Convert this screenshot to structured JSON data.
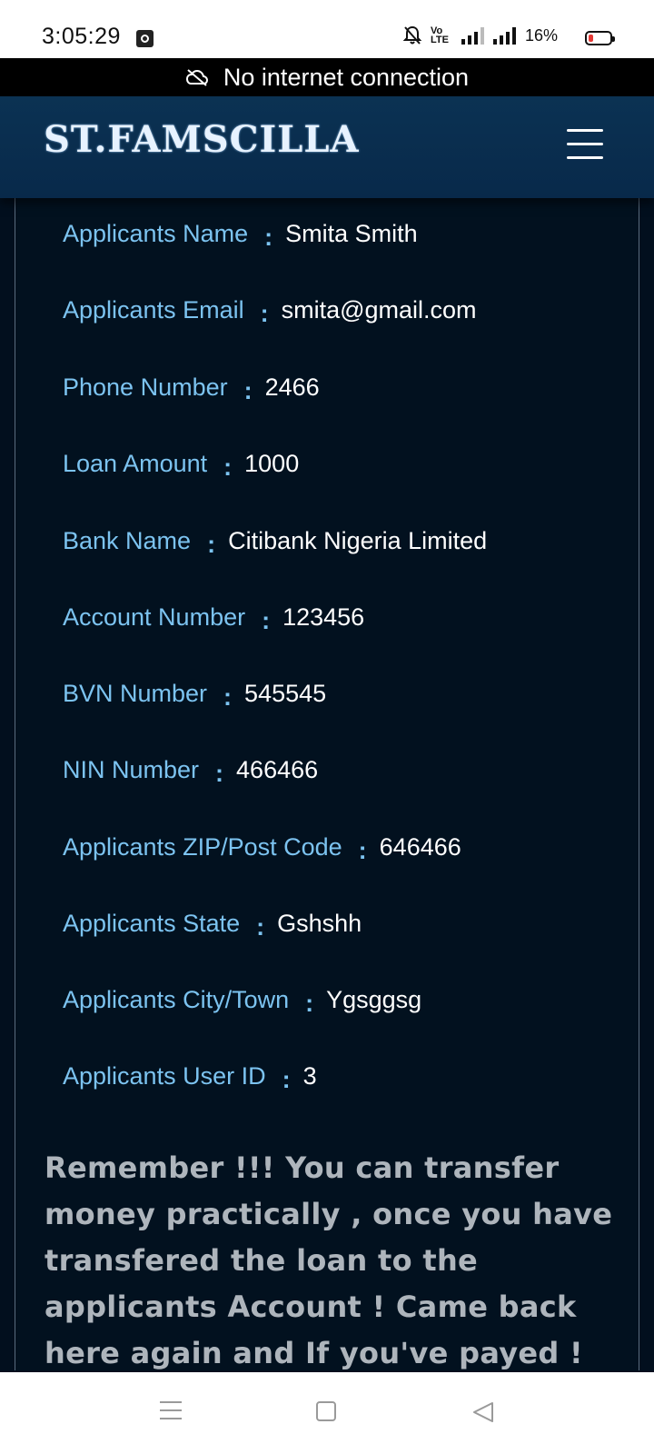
{
  "status_bar": {
    "time": "3:05:29",
    "battery_percent": "16%",
    "icons": [
      "app-notification-icon",
      "bell-off-icon",
      "volte-icon",
      "signal-icon",
      "signal-icon",
      "battery-icon"
    ],
    "volte_label": "Vo LTE"
  },
  "offline_banner": {
    "text": "No internet connection",
    "icon": "cloud-off-icon"
  },
  "header": {
    "brand": "ST.FAMSCILLA",
    "menu_icon": "hamburger-menu-icon"
  },
  "details": [
    {
      "label": "Applicants Name",
      "value": "Smita Smith"
    },
    {
      "label": "Applicants Email",
      "value": "smita@gmail.com"
    },
    {
      "label": "Phone Number",
      "value": "2466"
    },
    {
      "label": "Loan Amount",
      "value": "1000"
    },
    {
      "label": "Bank Name",
      "value": "Citibank Nigeria Limited"
    },
    {
      "label": "Account Number",
      "value": "123456"
    },
    {
      "label": "BVN Number",
      "value": "545545"
    },
    {
      "label": "NIN Number",
      "value": "466466"
    },
    {
      "label": "Applicants ZIP/Post Code",
      "value": "646466"
    },
    {
      "label": "Applicants State",
      "value": "Gshshh"
    },
    {
      "label": "Applicants City/Town",
      "value": "Ygsggsg"
    },
    {
      "label": "Applicants User ID",
      "value": "3"
    }
  ],
  "separator": ":",
  "notice_text": "Remember !!! You can transfer money practically , once you have transfered the loan to the applicants Account ! Came back here again and If you've payed ! just claim it that you've payed",
  "colors": {
    "background": "#020f1e",
    "header": "#0b3253",
    "label": "#7cc3f0",
    "value": "#ffffff",
    "notice": "#aeb5bc"
  },
  "nav_bar": {
    "icons": [
      "recent-apps-icon",
      "home-icon",
      "back-icon"
    ]
  }
}
